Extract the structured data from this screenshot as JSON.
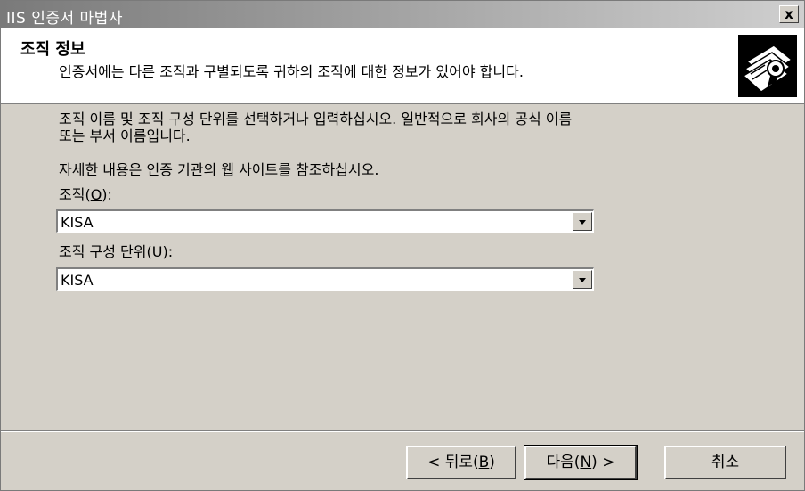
{
  "window": {
    "title": "IIS 인증서 마법사",
    "close_label": "x"
  },
  "header": {
    "title": "조직 정보",
    "description": "인증서에는 다른 조직과 구별되도록 귀하의 조직에 대한 정보가 있어야 합니다.",
    "icon": "certificate-icon"
  },
  "body": {
    "line1": "조직 이름 및 조직 구성 단위를 선택하거나 입력하십시오. 일반적으로 회사의 공식 이름",
    "line2": "또는 부서 이름입니다.",
    "line3": "자세한 내용은 인증 기관의 웹 사이트를 참조하십시오."
  },
  "organization": {
    "label_pre": "조직(",
    "accel": "O",
    "label_post": "):",
    "value": "KISA"
  },
  "org_unit": {
    "label_pre": "조직 구성 단위(",
    "accel": "U",
    "label_post": "):",
    "value": "KISA"
  },
  "buttons": {
    "back": {
      "pre": "< 뒤로(",
      "accel": "B",
      "post": ")"
    },
    "next": {
      "pre": "다음(",
      "accel": "N",
      "post": ") >"
    },
    "cancel": "취소"
  }
}
